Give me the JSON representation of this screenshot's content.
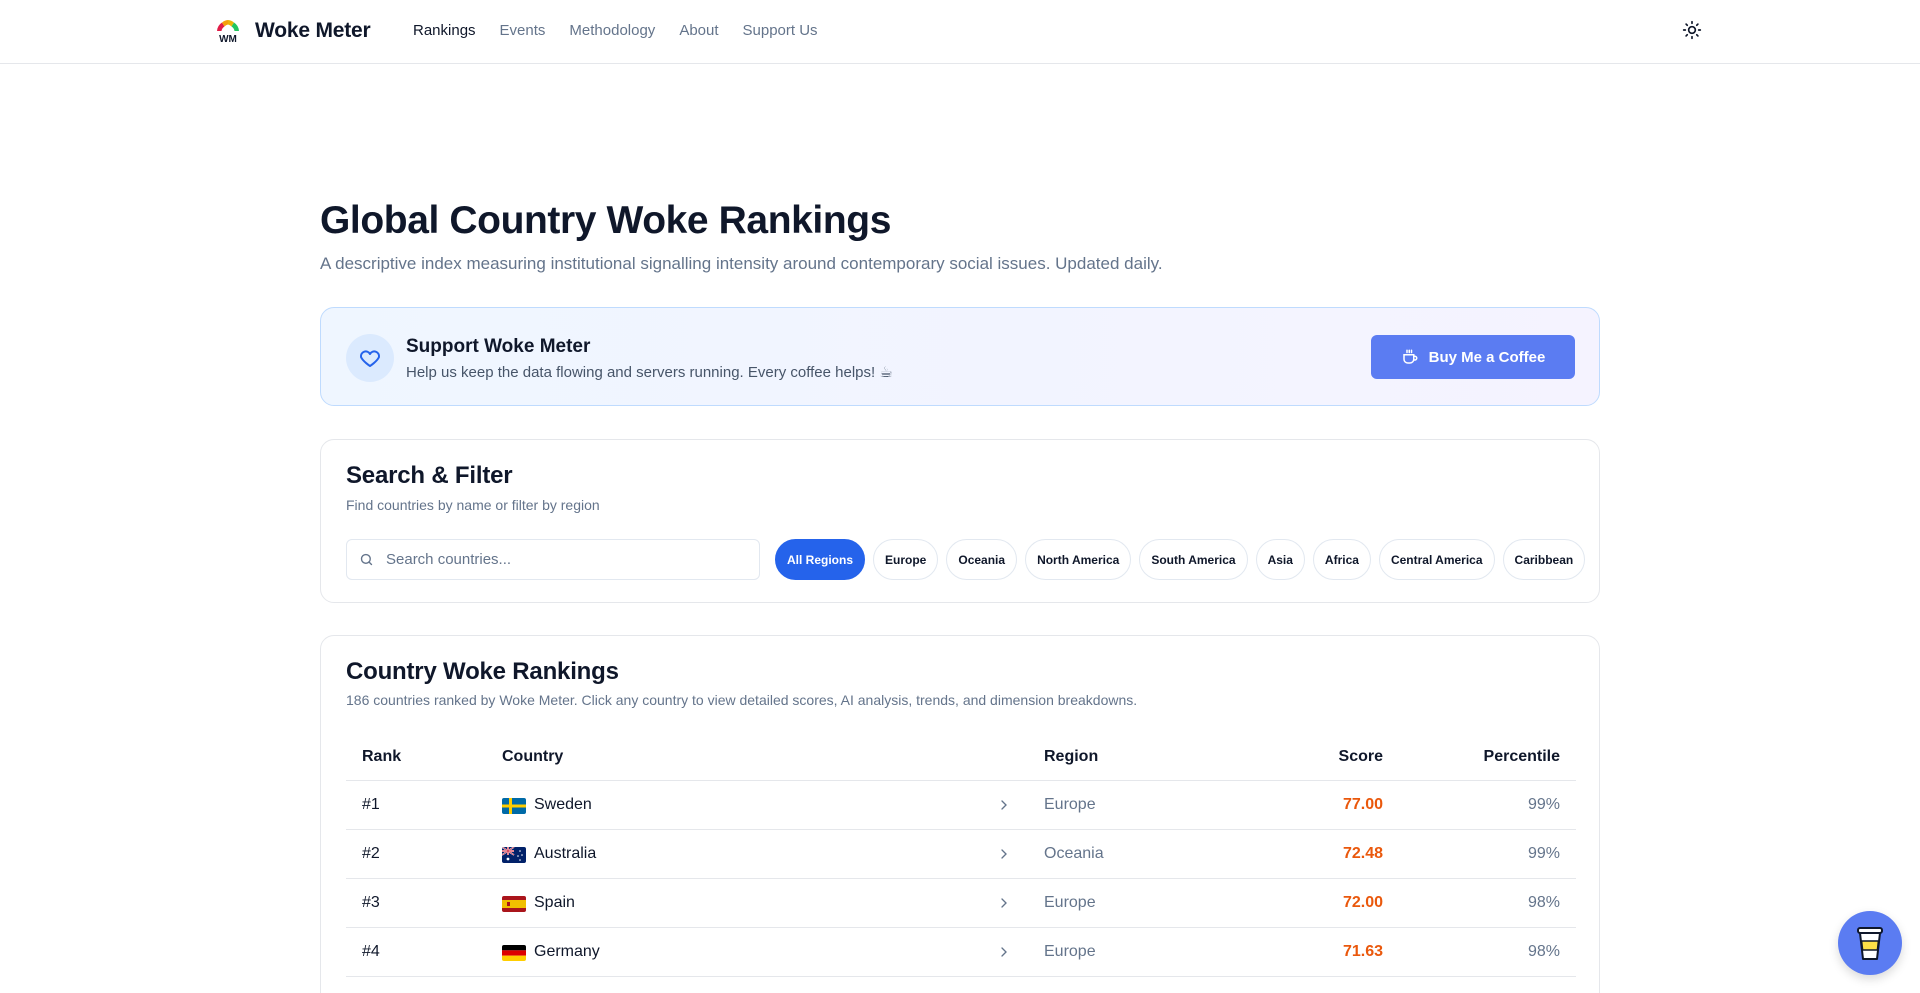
{
  "header": {
    "brand": "Woke Meter",
    "logo_text": "WM",
    "nav": [
      {
        "label": "Rankings",
        "active": true
      },
      {
        "label": "Events",
        "active": false
      },
      {
        "label": "Methodology",
        "active": false
      },
      {
        "label": "About",
        "active": false
      },
      {
        "label": "Support Us",
        "active": false
      }
    ],
    "theme_icon": "sun-icon"
  },
  "hero": {
    "title": "Global Country Woke Rankings",
    "subtitle": "A descriptive index measuring institutional signalling intensity around contemporary social issues. Updated daily."
  },
  "support": {
    "icon": "heart-icon",
    "title": "Support Woke Meter",
    "text": "Help us keep the data flowing and servers running. Every coffee helps! ☕",
    "button_label": "Buy Me a Coffee",
    "button_icon": "coffee-cup-icon"
  },
  "search": {
    "title": "Search & Filter",
    "subtitle": "Find countries by name or filter by region",
    "placeholder": "Search countries...",
    "value": "",
    "regions": [
      {
        "label": "All Regions",
        "active": true
      },
      {
        "label": "Europe",
        "active": false
      },
      {
        "label": "Oceania",
        "active": false
      },
      {
        "label": "North America",
        "active": false
      },
      {
        "label": "South America",
        "active": false
      },
      {
        "label": "Asia",
        "active": false
      },
      {
        "label": "Africa",
        "active": false
      },
      {
        "label": "Central America",
        "active": false
      },
      {
        "label": "Caribbean",
        "active": false
      }
    ]
  },
  "rankings": {
    "title": "Country Woke Rankings",
    "subtitle": "186 countries ranked by Woke Meter. Click any country to view detailed scores, AI analysis, trends, and dimension breakdowns.",
    "columns": {
      "rank": "Rank",
      "country": "Country",
      "region": "Region",
      "score": "Score",
      "percentile": "Percentile"
    },
    "rows": [
      {
        "rank": "#1",
        "country": "Sweden",
        "flag": "sweden-flag",
        "region": "Europe",
        "score": "77.00",
        "percentile": "99%"
      },
      {
        "rank": "#2",
        "country": "Australia",
        "flag": "australia-flag",
        "region": "Oceania",
        "score": "72.48",
        "percentile": "99%"
      },
      {
        "rank": "#3",
        "country": "Spain",
        "flag": "spain-flag",
        "region": "Europe",
        "score": "72.00",
        "percentile": "98%"
      },
      {
        "rank": "#4",
        "country": "Germany",
        "flag": "germany-flag",
        "region": "Europe",
        "score": "71.63",
        "percentile": "98%"
      }
    ]
  },
  "fab": {
    "icon": "coffee-cup-icon"
  },
  "colors": {
    "accent": "#2563eb",
    "button": "#5b7cf2",
    "score": "#ea580c",
    "muted": "#64748b"
  }
}
